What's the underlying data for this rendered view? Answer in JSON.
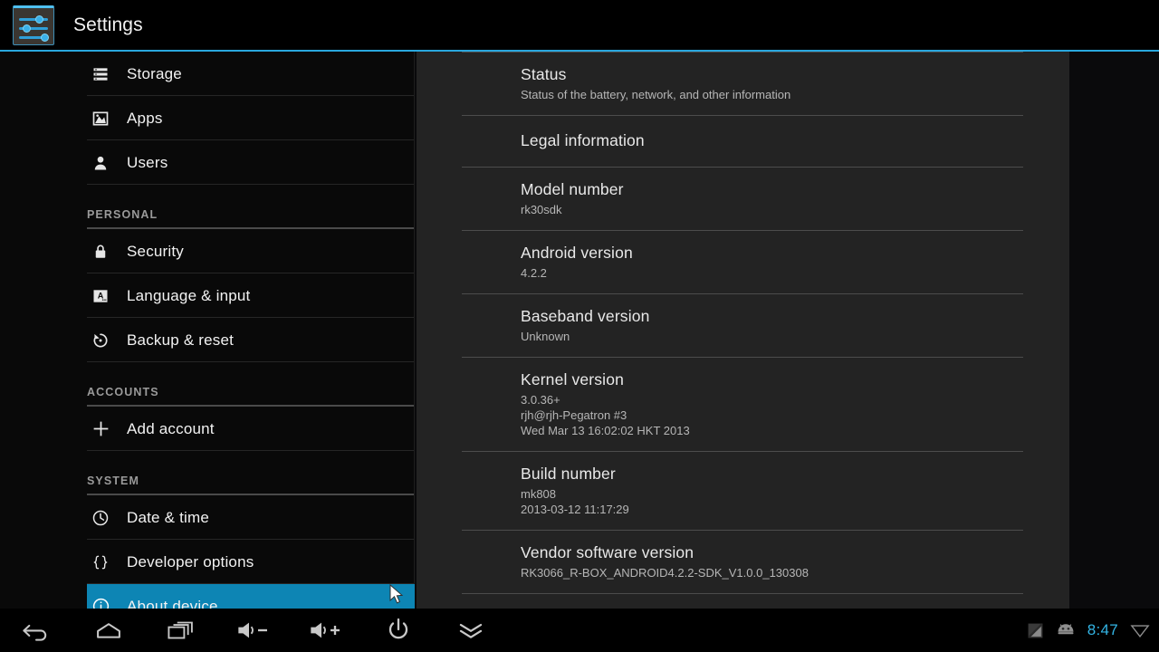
{
  "window": {
    "title": "Settings",
    "app_icon": "settings-sliders-icon",
    "accent_color": "#33b5e5",
    "selection_color": "#0d85b4"
  },
  "sidebar": {
    "items": [
      {
        "type": "item",
        "icon": "storage-icon",
        "label": "Storage",
        "selected": false
      },
      {
        "type": "item",
        "icon": "apps-icon",
        "label": "Apps",
        "selected": false
      },
      {
        "type": "item",
        "icon": "users-icon",
        "label": "Users",
        "selected": false
      },
      {
        "type": "header",
        "icon": "",
        "label": "PERSONAL",
        "selected": false
      },
      {
        "type": "item",
        "icon": "lock-icon",
        "label": "Security",
        "selected": false
      },
      {
        "type": "item",
        "icon": "language-icon",
        "label": "Language & input",
        "selected": false
      },
      {
        "type": "item",
        "icon": "backup-icon",
        "label": "Backup & reset",
        "selected": false
      },
      {
        "type": "header",
        "icon": "",
        "label": "ACCOUNTS",
        "selected": false
      },
      {
        "type": "item",
        "icon": "plus-icon",
        "label": "Add account",
        "selected": false
      },
      {
        "type": "header",
        "icon": "",
        "label": "SYSTEM",
        "selected": false
      },
      {
        "type": "item",
        "icon": "clock-icon",
        "label": "Date & time",
        "selected": false
      },
      {
        "type": "item",
        "icon": "braces-icon",
        "label": "Developer options",
        "selected": false
      },
      {
        "type": "item",
        "icon": "info-icon",
        "label": "About device",
        "selected": true
      }
    ]
  },
  "content": {
    "rows": [
      {
        "title": "Status",
        "subtitle": "Status of the battery, network, and other information"
      },
      {
        "title": "Legal information",
        "subtitle": ""
      },
      {
        "title": "Model number",
        "subtitle": "rk30sdk"
      },
      {
        "title": "Android version",
        "subtitle": "4.2.2"
      },
      {
        "title": "Baseband version",
        "subtitle": "Unknown"
      },
      {
        "title": "Kernel version",
        "subtitle": "3.0.36+\nrjh@rjh-Pegatron #3\nWed Mar 13 16:02:02 HKT 2013"
      },
      {
        "title": "Build number",
        "subtitle": "mk808\n2013-03-12   11:17:29"
      },
      {
        "title": "Vendor software version",
        "subtitle": "RK3066_R-BOX_ANDROID4.2.2-SDK_V1.0.0_130308"
      }
    ]
  },
  "navbar": {
    "buttons": [
      {
        "icon": "back-icon",
        "label": "Back"
      },
      {
        "icon": "home-icon",
        "label": "Home"
      },
      {
        "icon": "recents-icon",
        "label": "Recent apps"
      },
      {
        "icon": "volume-down-icon",
        "label": "Volume down"
      },
      {
        "icon": "volume-up-icon",
        "label": "Volume up"
      },
      {
        "icon": "power-icon",
        "label": "Power"
      },
      {
        "icon": "chevron-down-icon",
        "label": "Notifications"
      }
    ],
    "status": {
      "signal_icon": "no-signal-icon",
      "android_icon": "android-robot-icon",
      "time": "8:47",
      "wifi_icon": "wifi-icon"
    }
  }
}
